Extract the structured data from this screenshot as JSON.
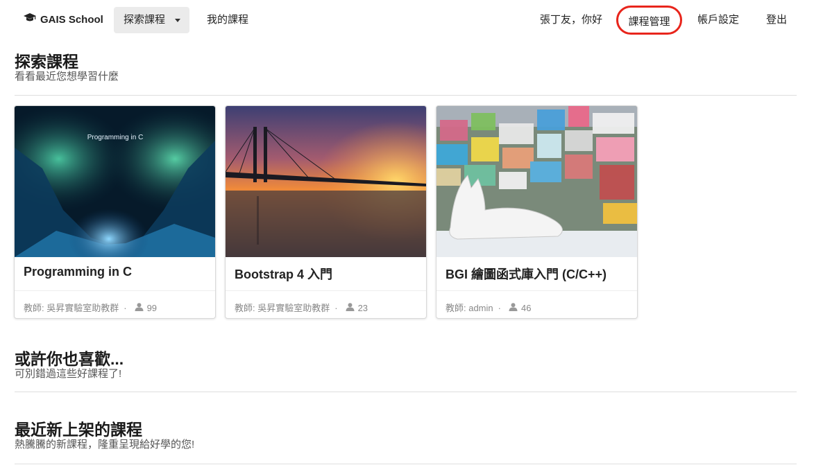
{
  "nav": {
    "brand": "GAIS School",
    "explore": "探索課程",
    "my_courses": "我的課程",
    "greeting": "張丁友，你好",
    "course_manage": "課程管理",
    "account_settings": "帳戶設定",
    "logout": "登出"
  },
  "sections": {
    "explore": {
      "title": "探索課程",
      "subtitle": "看看最近您想學習什麼"
    },
    "maybe": {
      "title": "或許你也喜歡...",
      "subtitle": "可別錯過這些好課程了!"
    },
    "latest": {
      "title": "最近新上架的課程",
      "subtitle": "熱騰騰的新課程，隆重呈現給好學的您!"
    }
  },
  "courses": [
    {
      "title": "Programming in C",
      "image_text": "Programming in C",
      "teacher": "教師: 吳昇實驗室助教群",
      "students": "99"
    },
    {
      "title": "Bootstrap 4 入門",
      "teacher": "教師: 吳昇實驗室助教群",
      "students": "23"
    },
    {
      "title": "BGI 繪圖函式庫入門 (C/C++)",
      "teacher": "教師: admin",
      "students": "46"
    }
  ],
  "colors": {
    "highlight_ring": "#e8251c",
    "explore_bg": "#ebebeb"
  }
}
